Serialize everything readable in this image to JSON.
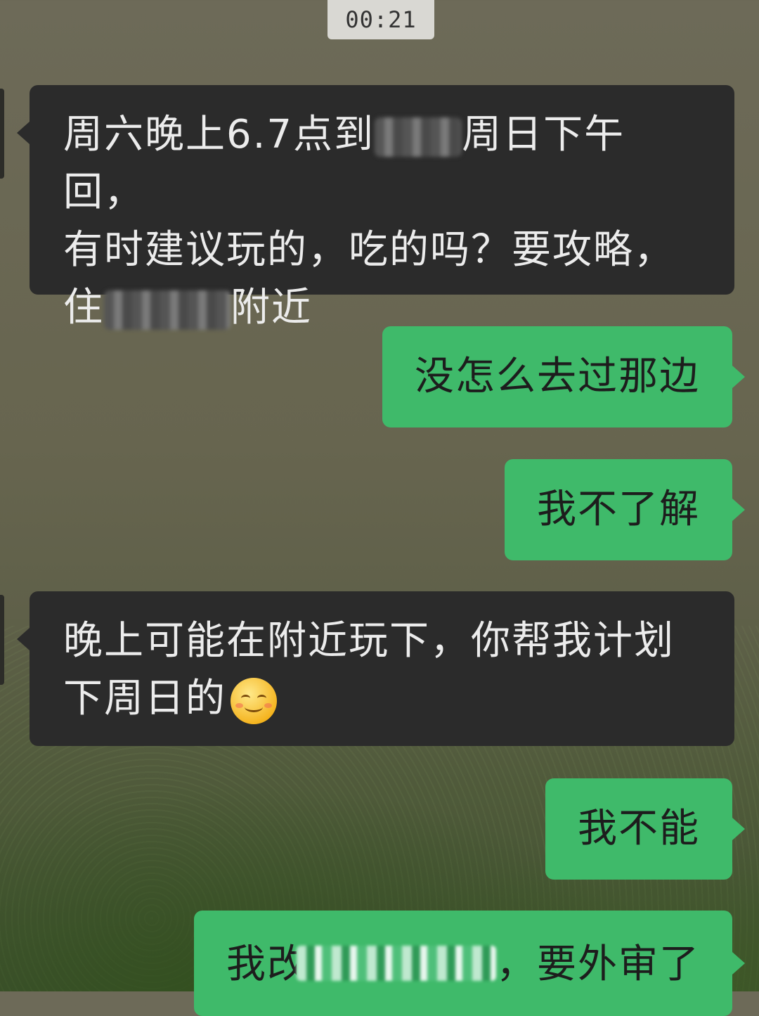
{
  "chat": {
    "timestamp": "00:21",
    "messages": [
      {
        "from": "other",
        "lines": [
          [
            "周六晚上6.7点到",
            "周日下午回，"
          ],
          [
            "有时建议玩的，吃的吗？要攻略，"
          ],
          [
            "住",
            "附近"
          ]
        ]
      },
      {
        "from": "me",
        "text": "没怎么去过那边"
      },
      {
        "from": "me",
        "text": "我不了解"
      },
      {
        "from": "other",
        "lines": [
          [
            "晚上可能在附近玩下，你帮我计划"
          ],
          [
            "下周日的"
          ]
        ],
        "emoji": "smiling-face-icon"
      },
      {
        "from": "me",
        "text": "我不能"
      },
      {
        "from": "me",
        "text_start": "我改论文很忙",
        "text_end": "，要外审了"
      }
    ]
  },
  "colors": {
    "incoming_bubble": "#2b2b2b",
    "outgoing_bubble": "#3fba6a",
    "timestamp_bg": "#d9d8d3"
  }
}
